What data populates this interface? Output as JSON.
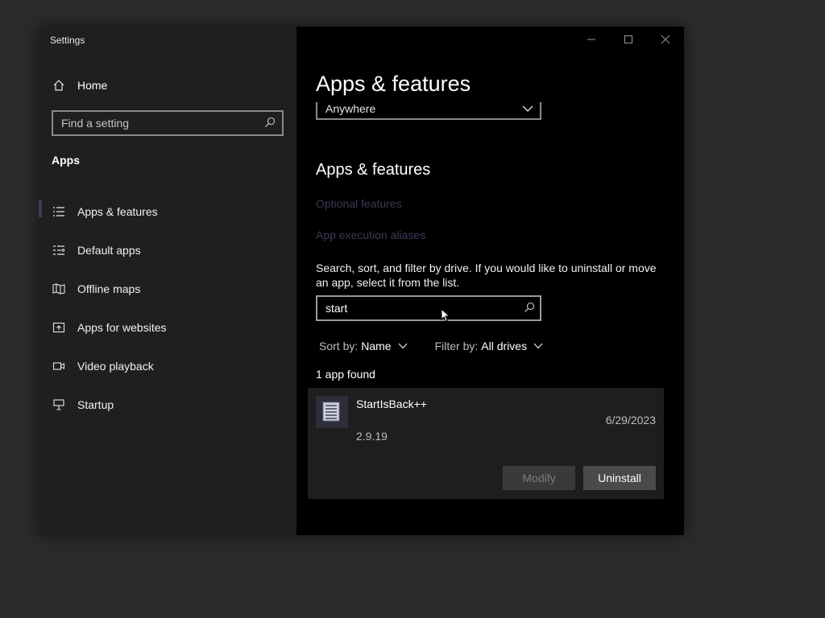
{
  "window": {
    "title": "Settings"
  },
  "sidebar": {
    "home_label": "Home",
    "search_placeholder": "Find a setting",
    "section": "Apps",
    "items": [
      {
        "label": "Apps & features",
        "icon": "list-icon",
        "active": true
      },
      {
        "label": "Default apps",
        "icon": "default-apps-icon",
        "active": false
      },
      {
        "label": "Offline maps",
        "icon": "map-icon",
        "active": false
      },
      {
        "label": "Apps for websites",
        "icon": "open-in-window-icon",
        "active": false
      },
      {
        "label": "Video playback",
        "icon": "video-icon",
        "active": false
      },
      {
        "label": "Startup",
        "icon": "startup-icon",
        "active": false
      }
    ]
  },
  "main": {
    "page_title": "Apps & features",
    "install_source_value": "Anywhere",
    "section_title": "Apps & features",
    "links": [
      "Optional features",
      "App execution aliases"
    ],
    "description": "Search, sort, and filter by drive. If you would like to uninstall or move an app, select it from the list.",
    "search_value": "start",
    "sort_label": "Sort by:",
    "sort_value": "Name",
    "filter_label": "Filter by:",
    "filter_value": "All drives",
    "results_text": "1 app found",
    "app": {
      "name": "StartIsBack++",
      "version": "2.9.19",
      "date": "6/29/2023",
      "modify_label": "Modify",
      "uninstall_label": "Uninstall"
    }
  },
  "colors": {
    "sidebar_bg": "#1f1f1f",
    "main_bg": "#000000",
    "desktop_bg": "#2b2b2b",
    "active_indicator": "#3b3b5c",
    "disabled_link": "#3b3b56"
  }
}
